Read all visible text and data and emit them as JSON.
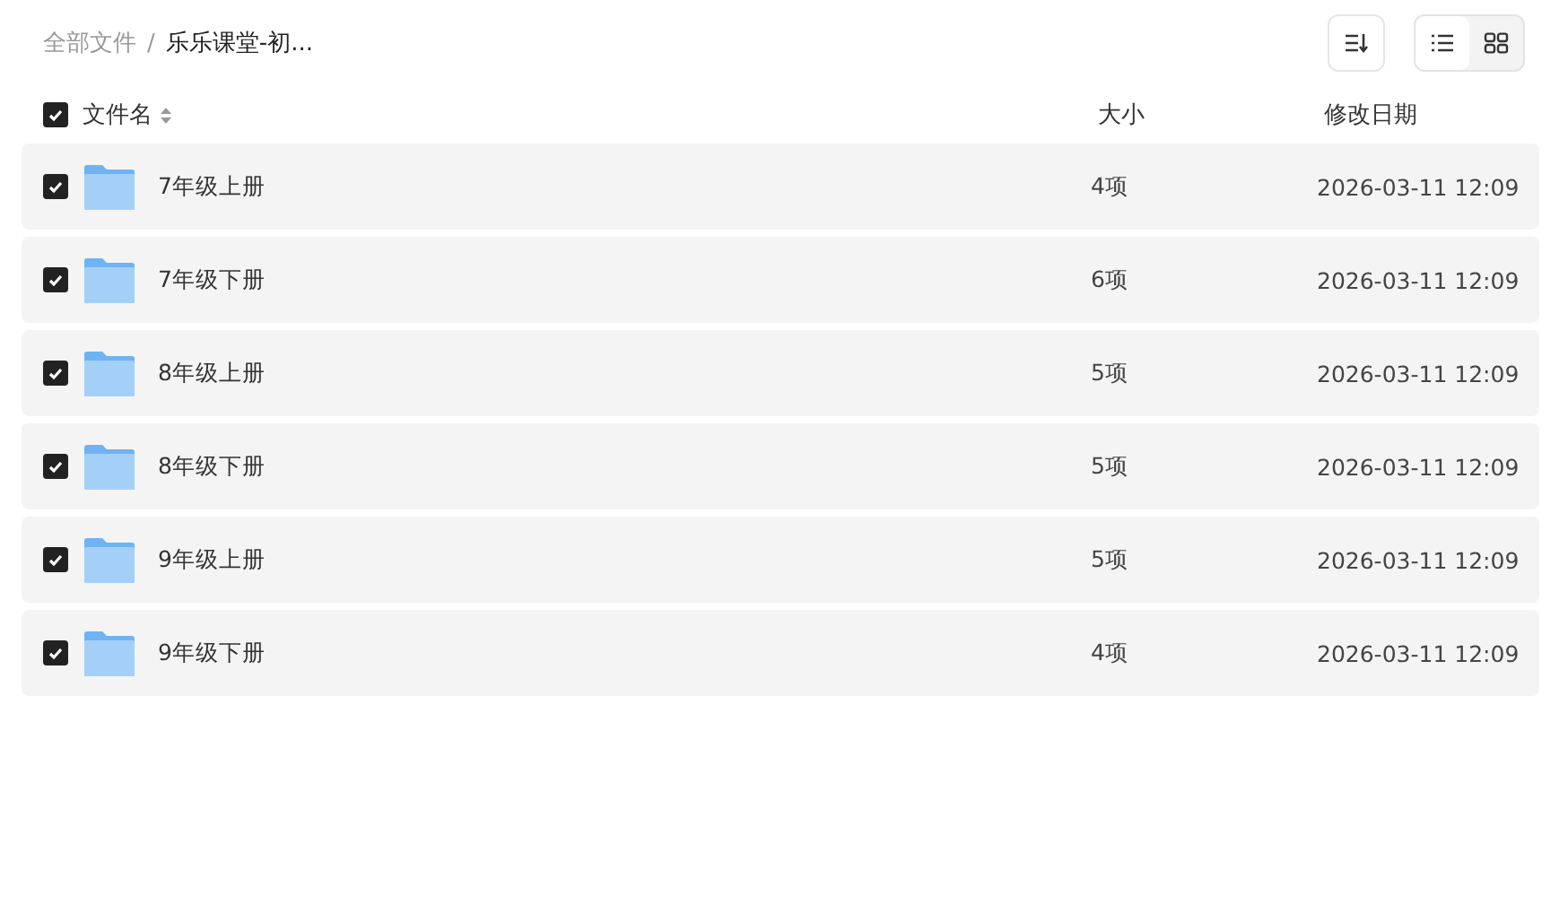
{
  "breadcrumb": [
    {
      "label": "全部文件",
      "selected": false
    },
    {
      "label": "乐乐课堂-初...",
      "selected": true
    }
  ],
  "breadcrumb_separator": "/",
  "view_toggle": [
    {
      "kind": "list",
      "selected": true
    },
    {
      "kind": "grid",
      "selected": false
    }
  ],
  "table": {
    "select_all": {
      "checked": true
    },
    "columns": [
      "文件名",
      "大小",
      "修改日期"
    ],
    "rows": [
      {
        "name": "7年级上册",
        "size": "4项",
        "modified": "2026-03-11 12:09",
        "checked": true
      },
      {
        "name": "7年级下册",
        "size": "6项",
        "modified": "2026-03-11 12:09",
        "checked": true
      },
      {
        "name": "8年级上册",
        "size": "5项",
        "modified": "2026-03-11 12:09",
        "checked": true
      },
      {
        "name": "8年级下册",
        "size": "5项",
        "modified": "2026-03-11 12:09",
        "checked": true
      },
      {
        "name": "9年级上册",
        "size": "5项",
        "modified": "2026-03-11 12:09",
        "checked": true
      },
      {
        "name": "9年级下册",
        "size": "4项",
        "modified": "2026-03-11 12:09",
        "checked": true
      }
    ]
  }
}
